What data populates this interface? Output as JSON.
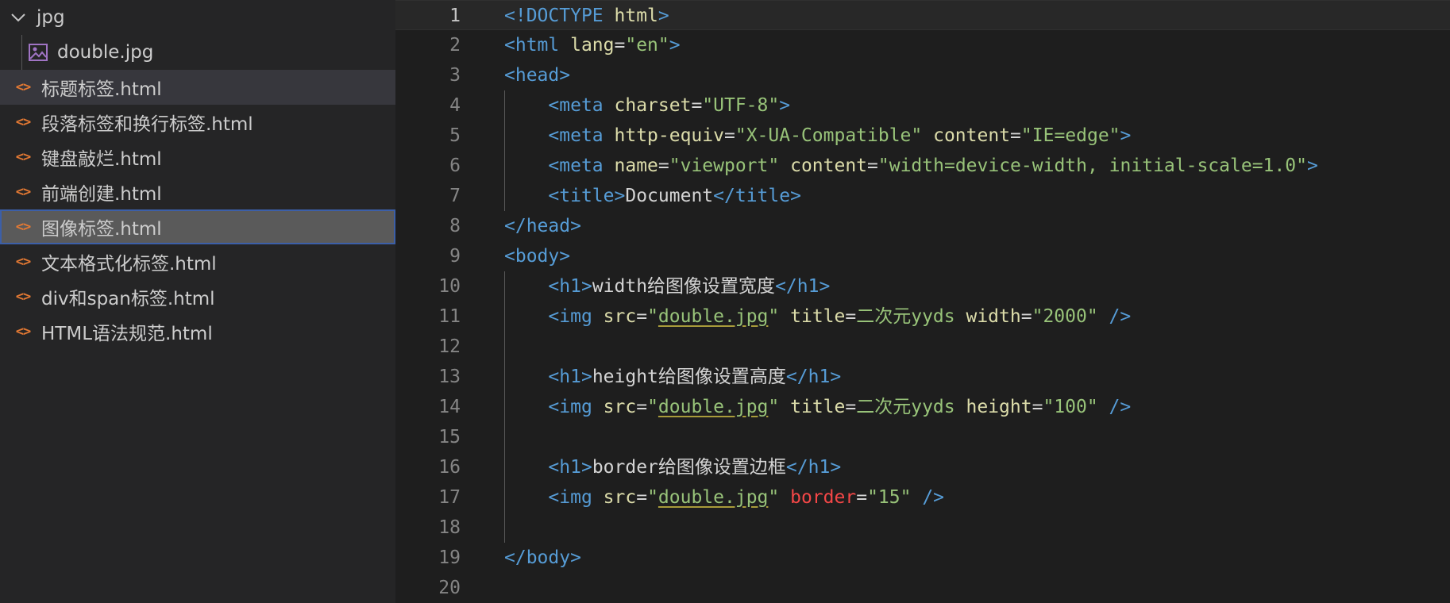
{
  "explorer": {
    "folder": {
      "name": "jpg",
      "expanded": true,
      "icon": "chevron-down-icon"
    },
    "folder_children": [
      {
        "name": "double.jpg",
        "icon": "image-file-icon"
      }
    ],
    "files": [
      {
        "name": "标题标签.html",
        "icon": "html-file-icon",
        "state": "hover"
      },
      {
        "name": "段落标签和换行标签.html",
        "icon": "html-file-icon",
        "state": ""
      },
      {
        "name": "键盘敲烂.html",
        "icon": "html-file-icon",
        "state": ""
      },
      {
        "name": "前端创建.html",
        "icon": "html-file-icon",
        "state": ""
      },
      {
        "name": "图像标签.html",
        "icon": "html-file-icon",
        "state": "selected"
      },
      {
        "name": "文本格式化标签.html",
        "icon": "html-file-icon",
        "state": ""
      },
      {
        "name": "div和span标签.html",
        "icon": "html-file-icon",
        "state": ""
      },
      {
        "name": "HTML语法规范.html",
        "icon": "html-file-icon",
        "state": ""
      }
    ]
  },
  "editor": {
    "current_line": 1,
    "colors": {
      "background": "#1e1e1e",
      "tag": "#569cd6",
      "attribute": "#dcdcaa",
      "string": "#98c379",
      "error": "#f44747"
    },
    "lines": [
      {
        "n": "1",
        "segs": [
          [
            "p",
            "<!"
          ],
          [
            "t",
            "DOCTYPE"
          ],
          [
            "tx",
            " "
          ],
          [
            "ay",
            "html"
          ],
          [
            "p",
            ">"
          ]
        ]
      },
      {
        "n": "2",
        "segs": [
          [
            "p",
            "<"
          ],
          [
            "t",
            "html"
          ],
          [
            "tx",
            " "
          ],
          [
            "ay",
            "lang"
          ],
          [
            "tx",
            "="
          ],
          [
            "sg",
            "\"en\""
          ],
          [
            "p",
            ">"
          ]
        ]
      },
      {
        "n": "3",
        "segs": [
          [
            "p",
            "<"
          ],
          [
            "t",
            "head"
          ],
          [
            "p",
            ">"
          ]
        ]
      },
      {
        "n": "4",
        "segs": [
          [
            "tx",
            "    "
          ],
          [
            "p",
            "<"
          ],
          [
            "t",
            "meta"
          ],
          [
            "tx",
            " "
          ],
          [
            "ay",
            "charset"
          ],
          [
            "tx",
            "="
          ],
          [
            "sg",
            "\"UTF-8\""
          ],
          [
            "p",
            ">"
          ]
        ]
      },
      {
        "n": "5",
        "segs": [
          [
            "tx",
            "    "
          ],
          [
            "p",
            "<"
          ],
          [
            "t",
            "meta"
          ],
          [
            "tx",
            " "
          ],
          [
            "ay",
            "http-equiv"
          ],
          [
            "tx",
            "="
          ],
          [
            "sg",
            "\"X-UA-Compatible\""
          ],
          [
            "tx",
            " "
          ],
          [
            "ay",
            "content"
          ],
          [
            "tx",
            "="
          ],
          [
            "sg",
            "\"IE=edge\""
          ],
          [
            "p",
            ">"
          ]
        ]
      },
      {
        "n": "6",
        "segs": [
          [
            "tx",
            "    "
          ],
          [
            "p",
            "<"
          ],
          [
            "t",
            "meta"
          ],
          [
            "tx",
            " "
          ],
          [
            "ay",
            "name"
          ],
          [
            "tx",
            "="
          ],
          [
            "sg",
            "\"viewport\""
          ],
          [
            "tx",
            " "
          ],
          [
            "ay",
            "content"
          ],
          [
            "tx",
            "="
          ],
          [
            "sg",
            "\"width=device-width, initial-scale=1.0\""
          ],
          [
            "p",
            ">"
          ]
        ]
      },
      {
        "n": "7",
        "segs": [
          [
            "tx",
            "    "
          ],
          [
            "p",
            "<"
          ],
          [
            "t",
            "title"
          ],
          [
            "p",
            ">"
          ],
          [
            "tx",
            "Document"
          ],
          [
            "p",
            "</"
          ],
          [
            "t",
            "title"
          ],
          [
            "p",
            ">"
          ]
        ]
      },
      {
        "n": "8",
        "segs": [
          [
            "p",
            "</"
          ],
          [
            "t",
            "head"
          ],
          [
            "p",
            ">"
          ]
        ]
      },
      {
        "n": "9",
        "segs": [
          [
            "p",
            "<"
          ],
          [
            "t",
            "body"
          ],
          [
            "p",
            ">"
          ]
        ]
      },
      {
        "n": "10",
        "segs": [
          [
            "tx",
            "    "
          ],
          [
            "p",
            "<"
          ],
          [
            "t",
            "h1"
          ],
          [
            "p",
            ">"
          ],
          [
            "tx",
            "width给图像设置宽度"
          ],
          [
            "p",
            "</"
          ],
          [
            "t",
            "h1"
          ],
          [
            "p",
            ">"
          ]
        ]
      },
      {
        "n": "11",
        "segs": [
          [
            "tx",
            "    "
          ],
          [
            "p",
            "<"
          ],
          [
            "t",
            "img"
          ],
          [
            "tx",
            " "
          ],
          [
            "ay",
            "src"
          ],
          [
            "tx",
            "="
          ],
          [
            "sg",
            "\""
          ],
          [
            "sgu",
            "double.jpg"
          ],
          [
            "sg",
            "\""
          ],
          [
            "tx",
            " "
          ],
          [
            "ay",
            "title"
          ],
          [
            "tx",
            "="
          ],
          [
            "sg",
            "二次元yyds"
          ],
          [
            "tx",
            " "
          ],
          [
            "ay",
            "width"
          ],
          [
            "tx",
            "="
          ],
          [
            "sg",
            "\"2000\""
          ],
          [
            "tx",
            " "
          ],
          [
            "p",
            "/>"
          ]
        ]
      },
      {
        "n": "12",
        "segs": []
      },
      {
        "n": "13",
        "segs": [
          [
            "tx",
            "    "
          ],
          [
            "p",
            "<"
          ],
          [
            "t",
            "h1"
          ],
          [
            "p",
            ">"
          ],
          [
            "tx",
            "height给图像设置高度"
          ],
          [
            "p",
            "</"
          ],
          [
            "t",
            "h1"
          ],
          [
            "p",
            ">"
          ]
        ]
      },
      {
        "n": "14",
        "segs": [
          [
            "tx",
            "    "
          ],
          [
            "p",
            "<"
          ],
          [
            "t",
            "img"
          ],
          [
            "tx",
            " "
          ],
          [
            "ay",
            "src"
          ],
          [
            "tx",
            "="
          ],
          [
            "sg",
            "\""
          ],
          [
            "sgu",
            "double.jpg"
          ],
          [
            "sg",
            "\""
          ],
          [
            "tx",
            " "
          ],
          [
            "ay",
            "title"
          ],
          [
            "tx",
            "="
          ],
          [
            "sg",
            "二次元yyds"
          ],
          [
            "tx",
            " "
          ],
          [
            "ay",
            "height"
          ],
          [
            "tx",
            "="
          ],
          [
            "sg",
            "\"100\""
          ],
          [
            "tx",
            " "
          ],
          [
            "p",
            "/>"
          ]
        ]
      },
      {
        "n": "15",
        "segs": []
      },
      {
        "n": "16",
        "segs": [
          [
            "tx",
            "    "
          ],
          [
            "p",
            "<"
          ],
          [
            "t",
            "h1"
          ],
          [
            "p",
            ">"
          ],
          [
            "tx",
            "border给图像设置边框"
          ],
          [
            "p",
            "</"
          ],
          [
            "t",
            "h1"
          ],
          [
            "p",
            ">"
          ]
        ]
      },
      {
        "n": "17",
        "segs": [
          [
            "tx",
            "    "
          ],
          [
            "p",
            "<"
          ],
          [
            "t",
            "img"
          ],
          [
            "tx",
            " "
          ],
          [
            "ay",
            "src"
          ],
          [
            "tx",
            "="
          ],
          [
            "sg",
            "\""
          ],
          [
            "sgu",
            "double.jpg"
          ],
          [
            "sg",
            "\""
          ],
          [
            "tx",
            " "
          ],
          [
            "err",
            "border"
          ],
          [
            "tx",
            "="
          ],
          [
            "sg",
            "\"15\""
          ],
          [
            "tx",
            " "
          ],
          [
            "p",
            "/>"
          ]
        ]
      },
      {
        "n": "18",
        "segs": []
      },
      {
        "n": "19",
        "segs": [
          [
            "p",
            "</"
          ],
          [
            "t",
            "body"
          ],
          [
            "p",
            ">"
          ]
        ]
      },
      {
        "n": "20",
        "segs": []
      }
    ]
  }
}
